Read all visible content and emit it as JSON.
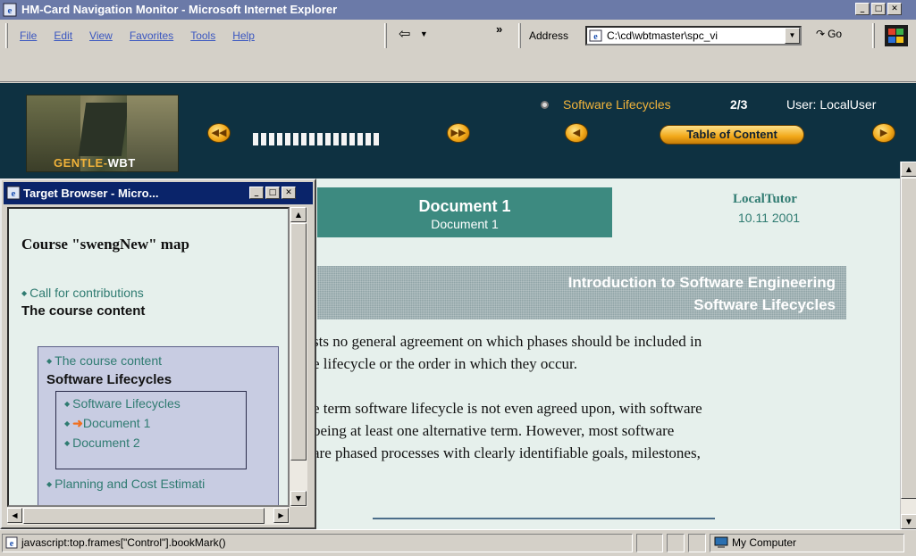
{
  "window": {
    "title": "HM-Card Navigation Monitor - Microsoft Internet Explorer",
    "controls": [
      "_",
      "□",
      "✕"
    ]
  },
  "menu": [
    "File",
    "Edit",
    "View",
    "Favorites",
    "Tools",
    "Help"
  ],
  "toolbar": {
    "chevron": "»",
    "address_label": "Address",
    "address_value": "C:\\cd\\wbtmaster\\spc_vi",
    "go_label": "Go"
  },
  "course_header": {
    "logo_text_left": "GENTLE",
    "logo_text_right": "WBT",
    "topic": "Software Lifecycles",
    "pager": "2/3",
    "user": "User: LocalUser",
    "toc_button": "Table of Content",
    "progress_segments": 16,
    "colors": {
      "background": "#0e3141",
      "accent": "#f2b43b",
      "button": "#f2a818"
    }
  },
  "document": {
    "title": "Document 1",
    "subtitle": "Document 1",
    "tutor": "LocalTutor",
    "date": "10.11 2001",
    "section_line1": "Introduction to Software Engineering",
    "section_line2": "Software Lifecycles",
    "paragraphs": [
      "sts no general agreement on which phases should be included in",
      "e lifecycle or the order in which they occur.",
      "e term software lifecycle is not even agreed upon, with software",
      "being at least one alternative term. However, most software",
      "are phased processes with clearly identifiable goals, milestones,"
    ],
    "trailing": "."
  },
  "status": {
    "text": "javascript:top.frames[\"Control\"].bookMark()",
    "zone": "My Computer"
  },
  "popup": {
    "title": "Target Browser - Micro...",
    "map_title": "Course \"swengNew\" map",
    "items": {
      "call": "Call for contributions",
      "course_content_bold": "The course content",
      "course_content_link": "The course content",
      "lifecycles_bold": "Software Lifecycles",
      "lifecycles_link": "Software Lifecycles",
      "doc1": "Document 1",
      "doc2": "Document 2",
      "planning": "Planning and Cost Estimati"
    }
  }
}
